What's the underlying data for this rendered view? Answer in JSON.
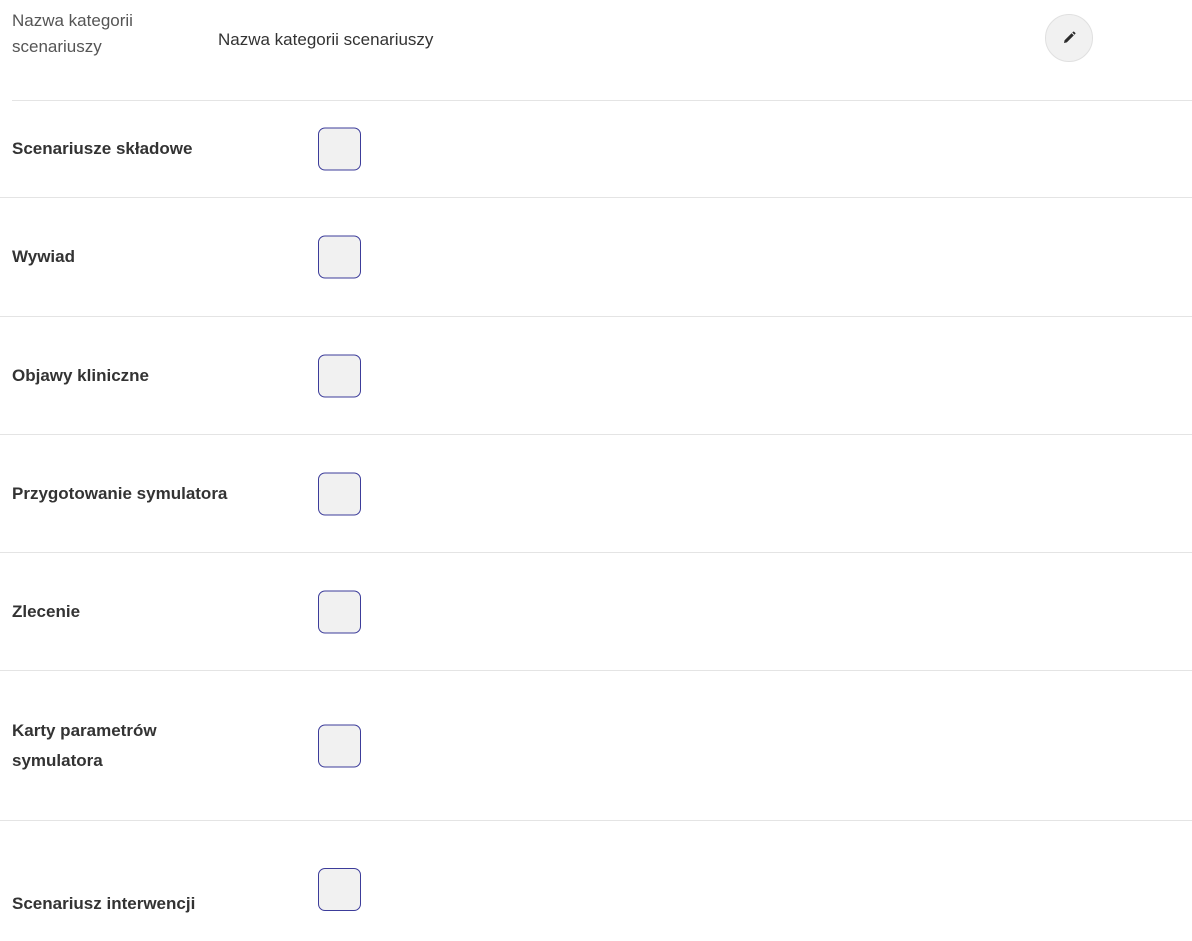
{
  "category": {
    "label": "Nazwa kategorii scenariuszy",
    "value": "Nazwa kategorii scenariuszy",
    "edit_icon": "pencil-icon"
  },
  "fields": [
    {
      "label": "Scenariusze składowe",
      "checked": false
    },
    {
      "label": "Wywiad",
      "checked": false
    },
    {
      "label": "Objawy kliniczne",
      "checked": false
    },
    {
      "label": "Przygotowanie symulatora",
      "checked": false
    },
    {
      "label": "Zlecenie",
      "checked": false
    },
    {
      "label": "Karty parametrów symulatora",
      "checked": false
    },
    {
      "label": "Scenariusz interwencji",
      "checked": false
    }
  ],
  "colors": {
    "checkbox_border": "#3c3c9a",
    "checkbox_fill": "#f1f1f1",
    "divider": "#e4e4e4"
  }
}
